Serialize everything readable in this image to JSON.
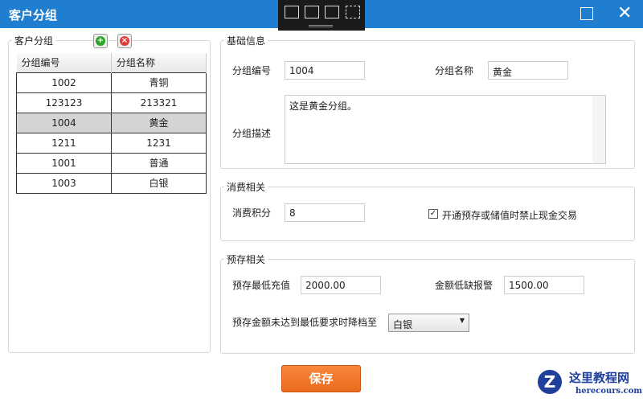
{
  "window": {
    "title": "客户分组"
  },
  "left": {
    "legend": "客户分组",
    "columns": [
      "分组编号",
      "分组名称"
    ],
    "rows": [
      [
        "1002",
        "青铜"
      ],
      [
        "123123",
        "213321"
      ],
      [
        "1004",
        "黄金"
      ],
      [
        "1211",
        "1231"
      ],
      [
        "1001",
        "普通"
      ],
      [
        "1003",
        "白银"
      ]
    ]
  },
  "basic": {
    "legend": "基础信息",
    "code_label": "分组编号",
    "code_value": "1004",
    "name_label": "分组名称",
    "name_value": "黄金",
    "desc_label": "分组描述",
    "desc_value": "这是黄金分组。"
  },
  "consume": {
    "legend": "消费相关",
    "points_label": "消费积分",
    "points_value": "8",
    "checkbox_label": "开通预存或储值时禁止现金交易",
    "checkbox_checked": true
  },
  "prestore": {
    "legend": "预存相关",
    "min_label": "预存最低充值",
    "min_value": "2000.00",
    "alert_label": "金额低缺报警",
    "alert_value": "1500.00",
    "downgrade_label": "预存金额未达到最低要求时降档至",
    "downgrade_value": "白银"
  },
  "save_label": "保存",
  "watermark": {
    "title": "这里教程网",
    "url": "herecours.com"
  }
}
